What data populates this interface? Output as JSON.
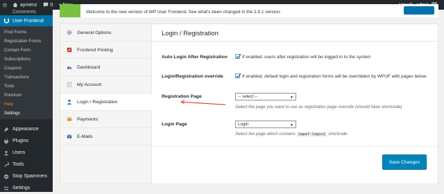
{
  "adminbar": {
    "site_name": "aymenz",
    "comments_count": "0",
    "new_label": "+ New",
    "howdy": "Howdy, admin"
  },
  "sidebar": {
    "cutoff_item": "Comments",
    "current_menu": "User Frontend",
    "submenu": [
      "Post Forms",
      "Registration Forms",
      "Contact Form",
      "Subscriptions",
      "Coupons",
      "Transactions",
      "Tools",
      "Premium",
      "Help",
      "Settings"
    ],
    "menu": [
      {
        "label": "Appearance",
        "icon": "paintbrush-icon"
      },
      {
        "label": "Plugins",
        "icon": "plugin-icon"
      },
      {
        "label": "Users",
        "icon": "users-icon"
      },
      {
        "label": "Tools",
        "icon": "wrench-icon"
      },
      {
        "label": "Stop Spammers",
        "icon": "shield-icon"
      },
      {
        "label": "Settings",
        "icon": "settings-icon"
      }
    ]
  },
  "notice": {
    "text": "Welcome to the new version of WP User Frontend. See what's been changed in the 2.8.1 version."
  },
  "tabs": [
    {
      "label": "General Options",
      "icon": "gear-icon"
    },
    {
      "label": "Frontend Posting",
      "icon": "edit-icon"
    },
    {
      "label": "Dashboard",
      "icon": "dashboard-icon"
    },
    {
      "label": "My Account",
      "icon": "account-icon"
    },
    {
      "label": "Login / Registration",
      "icon": "user-icon"
    },
    {
      "label": "Payments",
      "icon": "payments-icon"
    },
    {
      "label": "E-Mails",
      "icon": "email-icon"
    }
  ],
  "content": {
    "title": "Login / Registration",
    "auto_login": {
      "label": "Auto Login After Registration",
      "checked": true,
      "text": "If enabled, users after registration will be logged in to the system"
    },
    "override": {
      "label": "Login/Registration override",
      "checked": true,
      "text": "If enabled, default login and registration forms will be overridden by WPUF with pages below"
    },
    "registration_page": {
      "label": "Registration Page",
      "value": "-- select --",
      "desc": "Select the page you want to use as registration page override (should have shortcode)"
    },
    "login_page": {
      "label": "Login Page",
      "value": "Login",
      "desc_before": "Select the page which contains",
      "desc_code": "[wpuf-login]",
      "desc_after": "shortcode"
    },
    "save_label": "Save Changes"
  },
  "colors": {
    "admin_bar": "#23282d",
    "menu_current": "#0073aa",
    "submenu_current": "#f18500",
    "primary_button": "#0085ba",
    "arrow": "#e02020"
  }
}
